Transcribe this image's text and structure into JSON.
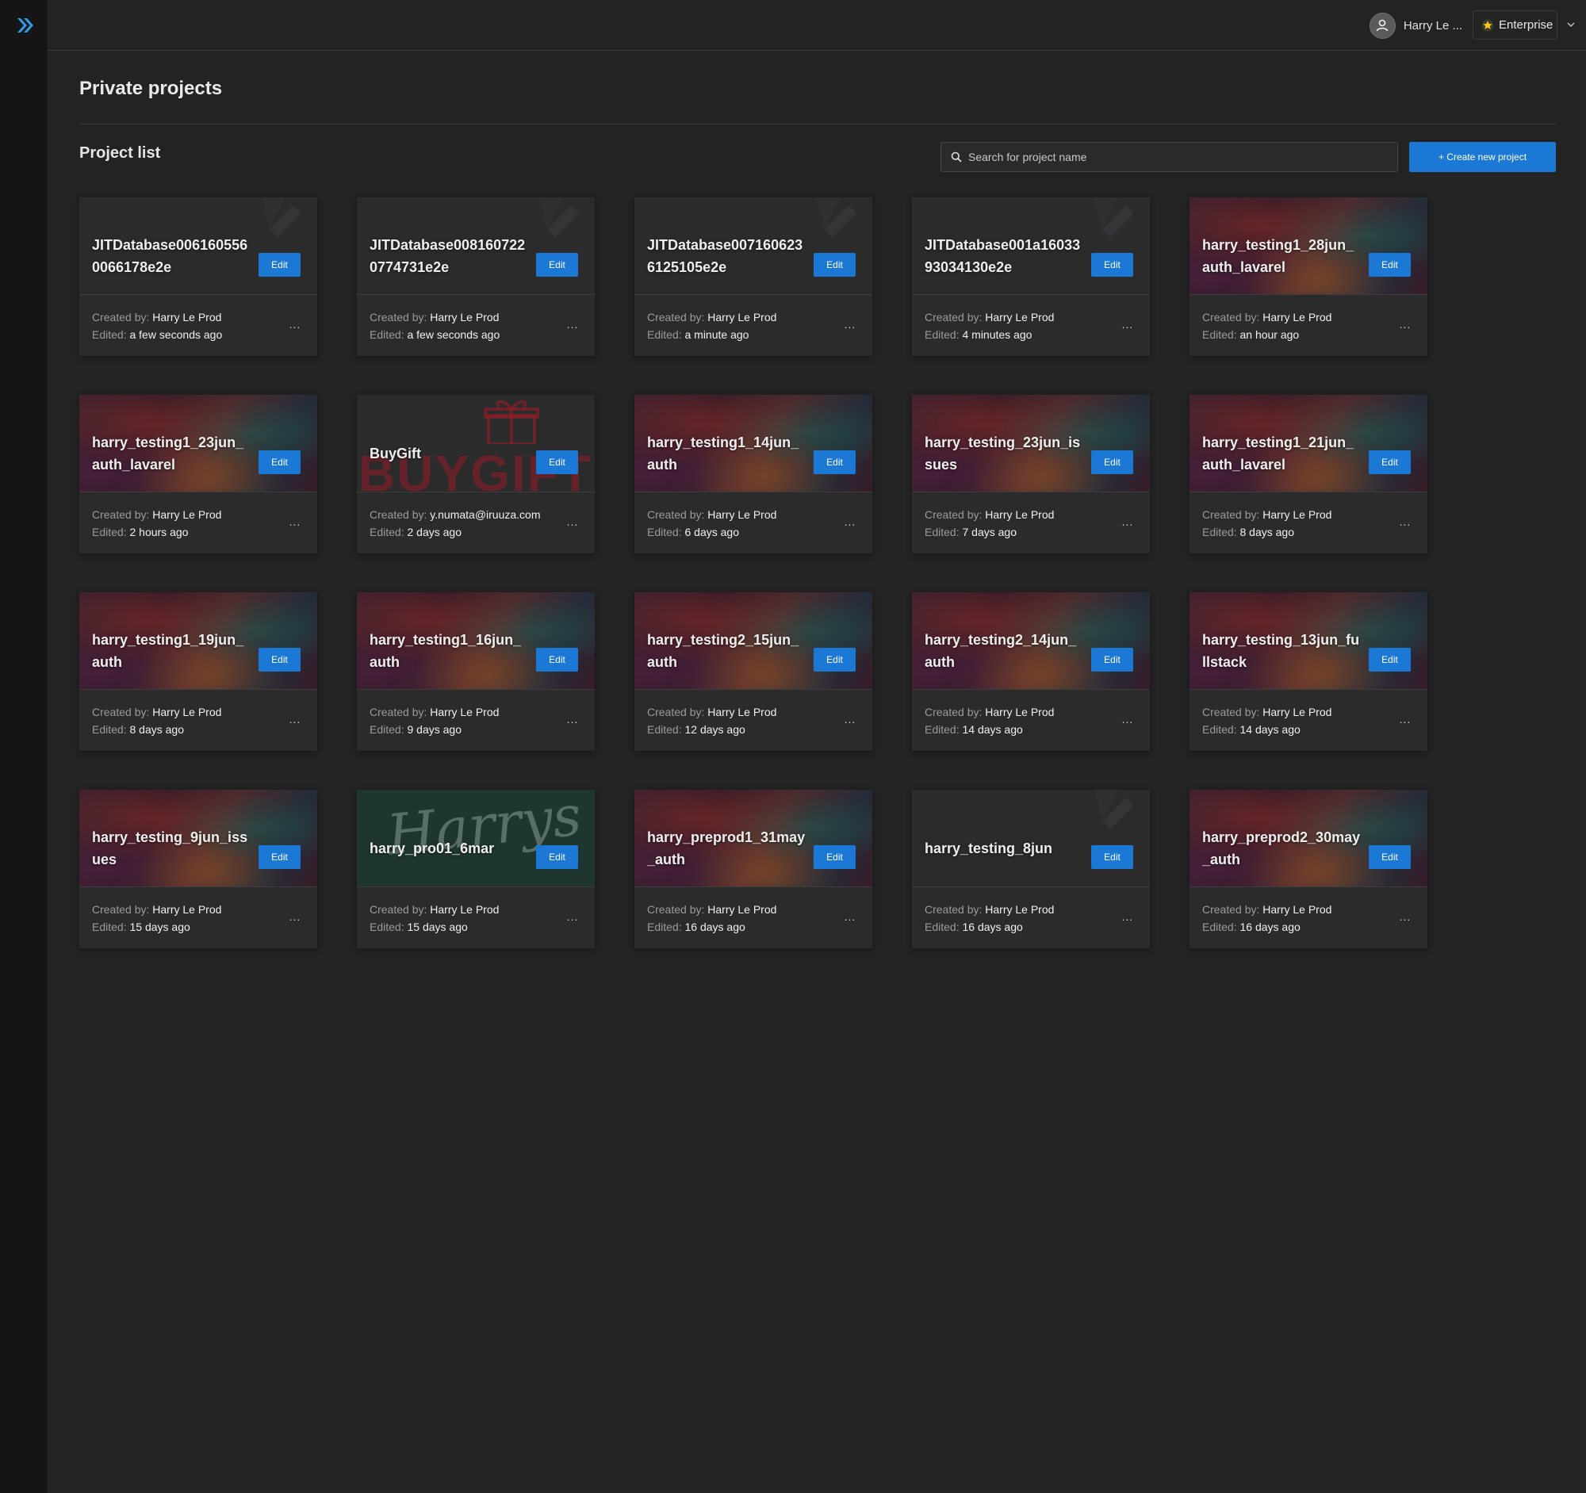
{
  "header": {
    "user_name": "Harry Le ...",
    "plan_label": "Enterprise"
  },
  "page": {
    "title": "Private projects",
    "section_title": "Project list",
    "search_placeholder": "Search for project name",
    "create_label": "+ Create new project"
  },
  "labels": {
    "created_by": "Created by:",
    "edited": "Edited:",
    "edit": "Edit",
    "more": "..."
  },
  "projects": [
    {
      "name": "JITDatabase0061605560066178e2e",
      "thumb": "plain",
      "created_by": "Harry Le Prod",
      "edited": "a few seconds ago"
    },
    {
      "name": "JITDatabase0081607220774731e2e",
      "thumb": "plain",
      "created_by": "Harry Le Prod",
      "edited": "a few seconds ago"
    },
    {
      "name": "JITDatabase0071606236125105e2e",
      "thumb": "plain",
      "created_by": "Harry Le Prod",
      "edited": "a minute ago"
    },
    {
      "name": "JITDatabase001a1603393034130e2e",
      "thumb": "plain",
      "created_by": "Harry Le Prod",
      "edited": "4 minutes ago"
    },
    {
      "name": "harry_testing1_28jun_auth_lavarel",
      "thumb": "anime",
      "created_by": "Harry Le Prod",
      "edited": "an hour ago"
    },
    {
      "name": "harry_testing1_23jun_auth_lavarel",
      "thumb": "anime",
      "created_by": "Harry Le Prod",
      "edited": "2 hours ago"
    },
    {
      "name": "BuyGift",
      "thumb": "gift",
      "created_by": "y.numata@iruuza.com",
      "edited": "2 days ago"
    },
    {
      "name": "harry_testing1_14jun_auth",
      "thumb": "anime",
      "created_by": "Harry Le Prod",
      "edited": "6 days ago"
    },
    {
      "name": "harry_testing_23jun_issues",
      "thumb": "anime",
      "created_by": "Harry Le Prod",
      "edited": "7 days ago"
    },
    {
      "name": "harry_testing1_21jun_auth_lavarel",
      "thumb": "anime",
      "created_by": "Harry Le Prod",
      "edited": "8 days ago"
    },
    {
      "name": "harry_testing1_19jun_auth",
      "thumb": "anime",
      "created_by": "Harry Le Prod",
      "edited": "8 days ago"
    },
    {
      "name": "harry_testing1_16jun_auth",
      "thumb": "anime",
      "created_by": "Harry Le Prod",
      "edited": "9 days ago"
    },
    {
      "name": "harry_testing2_15jun_auth",
      "thumb": "anime",
      "created_by": "Harry Le Prod",
      "edited": "12 days ago"
    },
    {
      "name": "harry_testing2_14jun_auth",
      "thumb": "anime",
      "created_by": "Harry Le Prod",
      "edited": "14 days ago"
    },
    {
      "name": "harry_testing_13jun_fullstack",
      "thumb": "anime",
      "created_by": "Harry Le Prod",
      "edited": "14 days ago"
    },
    {
      "name": "harry_testing_9jun_issues",
      "thumb": "anime",
      "created_by": "Harry Le Prod",
      "edited": "15 days ago"
    },
    {
      "name": "harry_pro01_6mar",
      "thumb": "harrys",
      "created_by": "Harry Le Prod",
      "edited": "15 days ago"
    },
    {
      "name": "harry_preprod1_31may_auth",
      "thumb": "anime",
      "created_by": "Harry Le Prod",
      "edited": "16 days ago"
    },
    {
      "name": "harry_testing_8jun",
      "thumb": "plain",
      "created_by": "Harry Le Prod",
      "edited": "16 days ago"
    },
    {
      "name": "harry_preprod2_30may_auth",
      "thumb": "anime",
      "created_by": "Harry Le Prod",
      "edited": "16 days ago"
    }
  ],
  "colors": {
    "accent": "#1b78d4",
    "background": "#232324",
    "sidebar": "#151516",
    "card": "#2b2b2c"
  },
  "icons": {
    "logo": "double-chevron-logo-icon",
    "avatar": "user-avatar-icon",
    "plan": "star-icon",
    "caret": "chevron-down-icon",
    "search": "search-icon"
  },
  "thumb_text": {
    "gift": "BUYGIFT",
    "harrys": "Harrys"
  }
}
